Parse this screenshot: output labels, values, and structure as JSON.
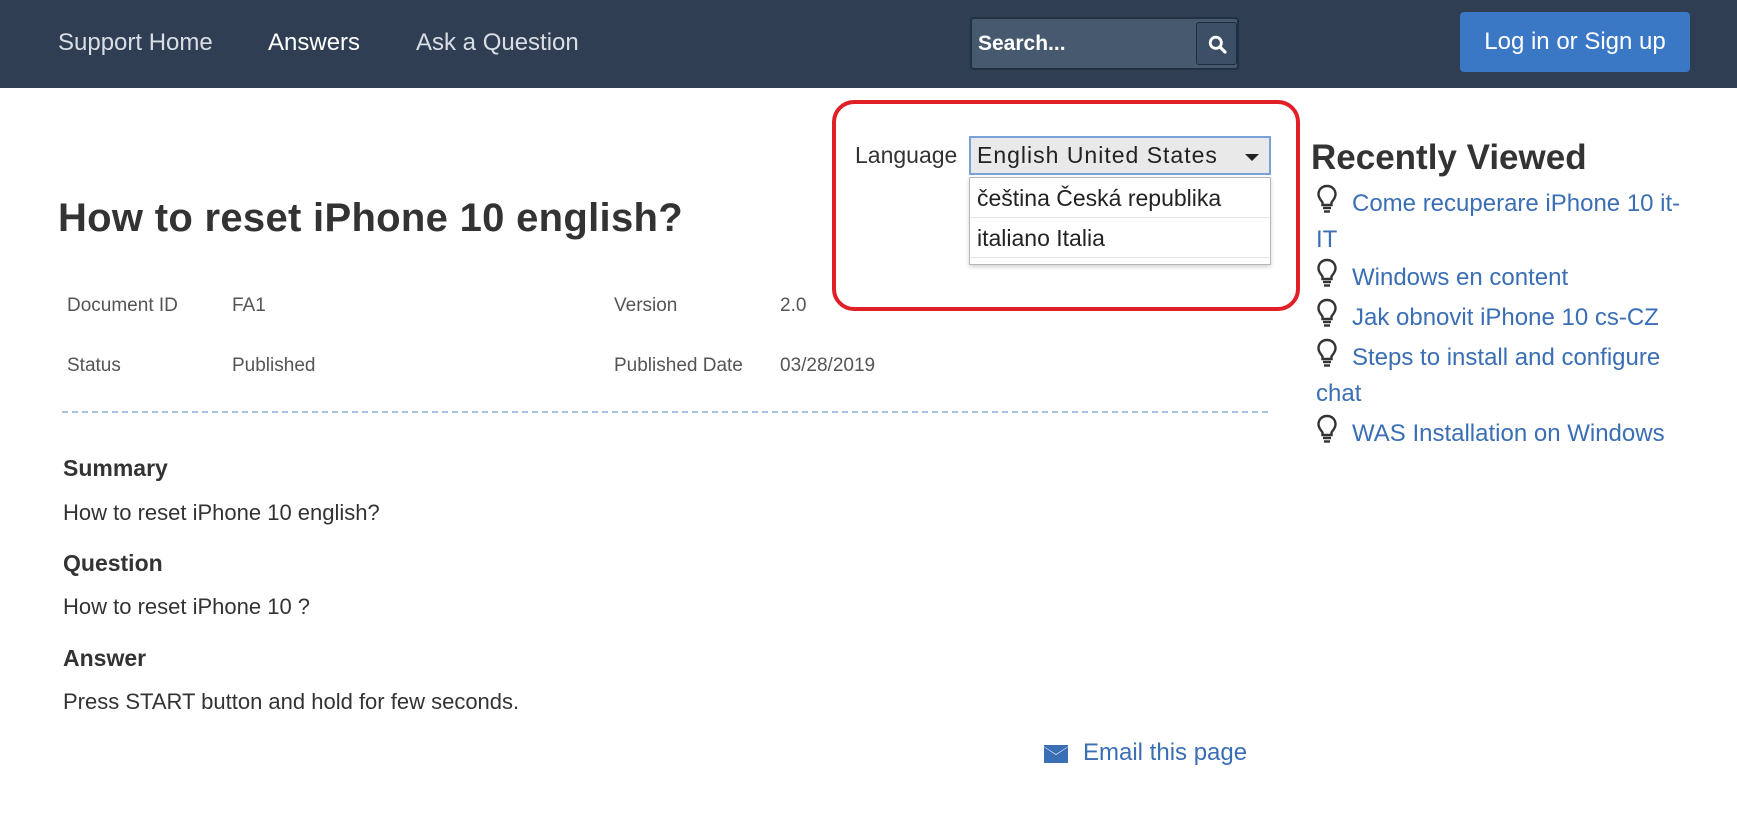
{
  "nav": {
    "support_home": "Support Home",
    "answers": "Answers",
    "ask_question": "Ask a Question"
  },
  "search": {
    "placeholder": "Search..."
  },
  "auth": {
    "login_label": "Log in or Sign up"
  },
  "language": {
    "label": "Language",
    "selected": "English United States",
    "options": [
      "čeština Česká republika",
      "italiano Italia"
    ]
  },
  "article": {
    "title": "How to reset iPhone 10 english?",
    "meta": {
      "document_id_label": "Document ID",
      "document_id": "FA1",
      "version_label": "Version",
      "version": "2.0",
      "status_label": "Status",
      "status": "Published",
      "published_date_label": "Published Date",
      "published_date": "03/28/2019"
    },
    "sections": [
      {
        "heading": "Summary",
        "body": "How to reset iPhone 10 english?"
      },
      {
        "heading": "Question",
        "body": "How to reset iPhone 10 ?"
      },
      {
        "heading": "Answer",
        "body": "Press START button and hold for few seconds."
      }
    ],
    "email_label": "Email this page"
  },
  "recently_viewed": {
    "title": "Recently Viewed",
    "items": [
      "Come recuperare iPhone 10 it-IT",
      "Windows en content",
      "Jak obnovit iPhone 10 cs-CZ",
      "Steps to install and configure chat",
      "WAS Installation on Windows"
    ]
  },
  "colors": {
    "header_bg": "#2f3e52",
    "accent_blue": "#3a78c6",
    "link_blue": "#3a6eb5",
    "highlight_red": "#e01f26"
  },
  "icons": {
    "search": "search-icon",
    "email": "envelope-icon",
    "recent_item": "lightbulb-icon"
  }
}
